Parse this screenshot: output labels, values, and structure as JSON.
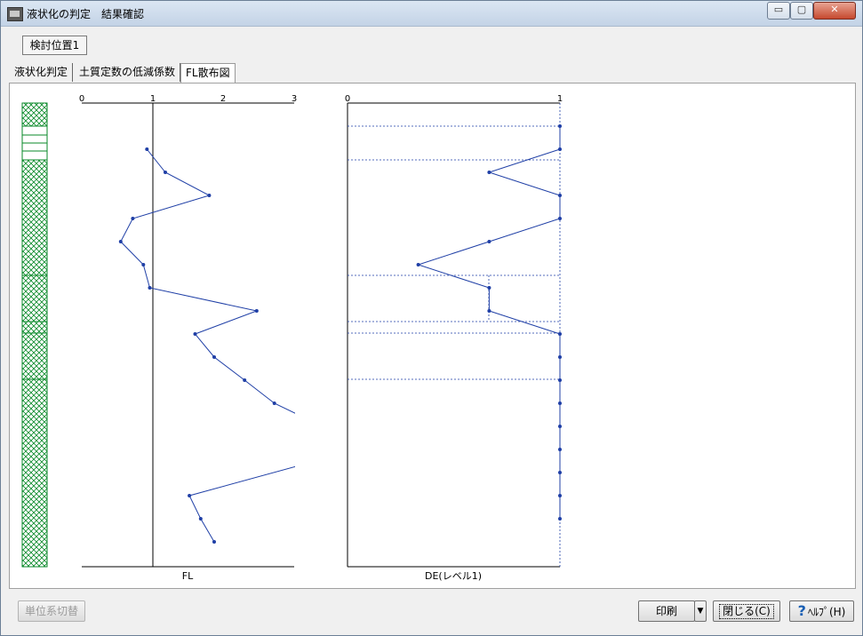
{
  "window": {
    "title": "液状化の判定　結果確認"
  },
  "title_buttons": {
    "minimize": "▭",
    "maximize": "▢",
    "close": "✕"
  },
  "position_tab": "検討位置1",
  "tabs": [
    "液状化判定",
    "土質定数の低減係数",
    "FL散布図"
  ],
  "colors": {
    "plot_line": "#1f3fa6",
    "soil_hatch": "#0a8a2a",
    "panel_bg": "#ffffff"
  },
  "chart_data": [
    {
      "type": "line",
      "xlabel": "FL",
      "xlim": [
        0,
        3
      ],
      "x_ticks": [
        "0",
        "1",
        "2",
        "3"
      ],
      "reference_line_x": 1,
      "points": [
        [
          0.92,
          1
        ],
        [
          1.18,
          2
        ],
        [
          1.8,
          3
        ],
        [
          0.72,
          4
        ],
        [
          0.55,
          5
        ],
        [
          0.87,
          6
        ],
        [
          0.96,
          7
        ],
        [
          2.47,
          8
        ],
        [
          1.6,
          9
        ],
        [
          1.87,
          10
        ],
        [
          2.3,
          11
        ],
        [
          2.72,
          12
        ],
        [
          3.4,
          13
        ],
        [
          3.9,
          14
        ],
        [
          1.52,
          16
        ],
        [
          1.68,
          17
        ],
        [
          1.87,
          18
        ]
      ]
    },
    {
      "type": "line",
      "xlabel": "DE(レベル1)",
      "xlim": [
        0,
        1
      ],
      "x_ticks": [
        "0",
        "1"
      ],
      "points": [
        [
          1,
          0
        ],
        [
          1,
          1
        ],
        [
          0.667,
          2
        ],
        [
          1,
          3
        ],
        [
          1,
          4
        ],
        [
          0.667,
          5
        ],
        [
          0.333,
          6
        ],
        [
          0.667,
          7
        ],
        [
          0.667,
          8
        ],
        [
          1,
          9
        ],
        [
          1,
          10
        ],
        [
          1,
          11
        ],
        [
          1,
          12
        ],
        [
          1,
          13
        ],
        [
          1,
          14
        ],
        [
          1,
          15
        ],
        [
          1,
          16
        ],
        [
          1,
          17
        ]
      ]
    }
  ],
  "bottom": {
    "unit_toggle": "単位系切替",
    "print": "印刷",
    "dropdown": "▼",
    "close": "閉じる(C)",
    "help_icon": "?",
    "help": "ﾍﾙﾌﾟ(H)"
  }
}
